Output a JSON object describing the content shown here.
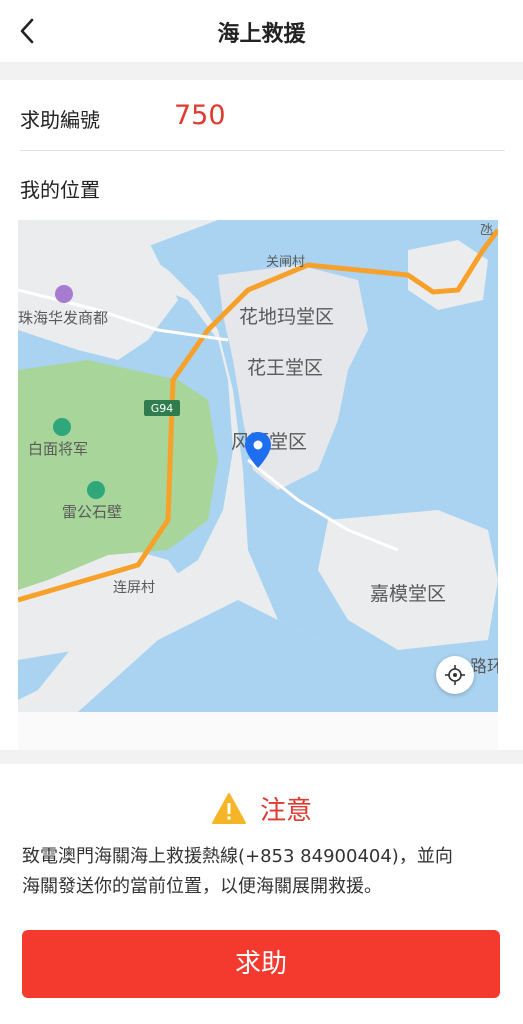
{
  "header": {
    "title": "海上救援",
    "back_icon": "chevron-left-icon"
  },
  "request": {
    "label": "求助編號",
    "value": "750"
  },
  "location": {
    "label": "我的位置"
  },
  "map": {
    "labels": {
      "guanzha": "关闸村",
      "huadi": "花地玛堂区",
      "huawang": "花王堂区",
      "fengshun": "风顺堂区",
      "jiamo": "嘉模堂区",
      "baimian": "白面将军",
      "leigong": "雷公石壁",
      "lianping": "连屏村",
      "zhuhai": "珠海华发商都",
      "g94": "G94",
      "luhuan": "路环",
      "top_right": "氹"
    },
    "locate_icon": "crosshair-icon",
    "pin_icon": "map-pin-icon",
    "colors": {
      "water": "#a9d3f0",
      "land": "#ebecee",
      "park": "#a8d59a",
      "road": "#f7a12b"
    }
  },
  "notice": {
    "icon": "warning-icon",
    "title": "注意",
    "line1": "致電澳門海關海上救援熱線(+853 84900404)，並向",
    "line2": "海關發送你的當前位置，以便海關展開救援。"
  },
  "action": {
    "button_label": "求助",
    "color": "#f43a2f"
  }
}
